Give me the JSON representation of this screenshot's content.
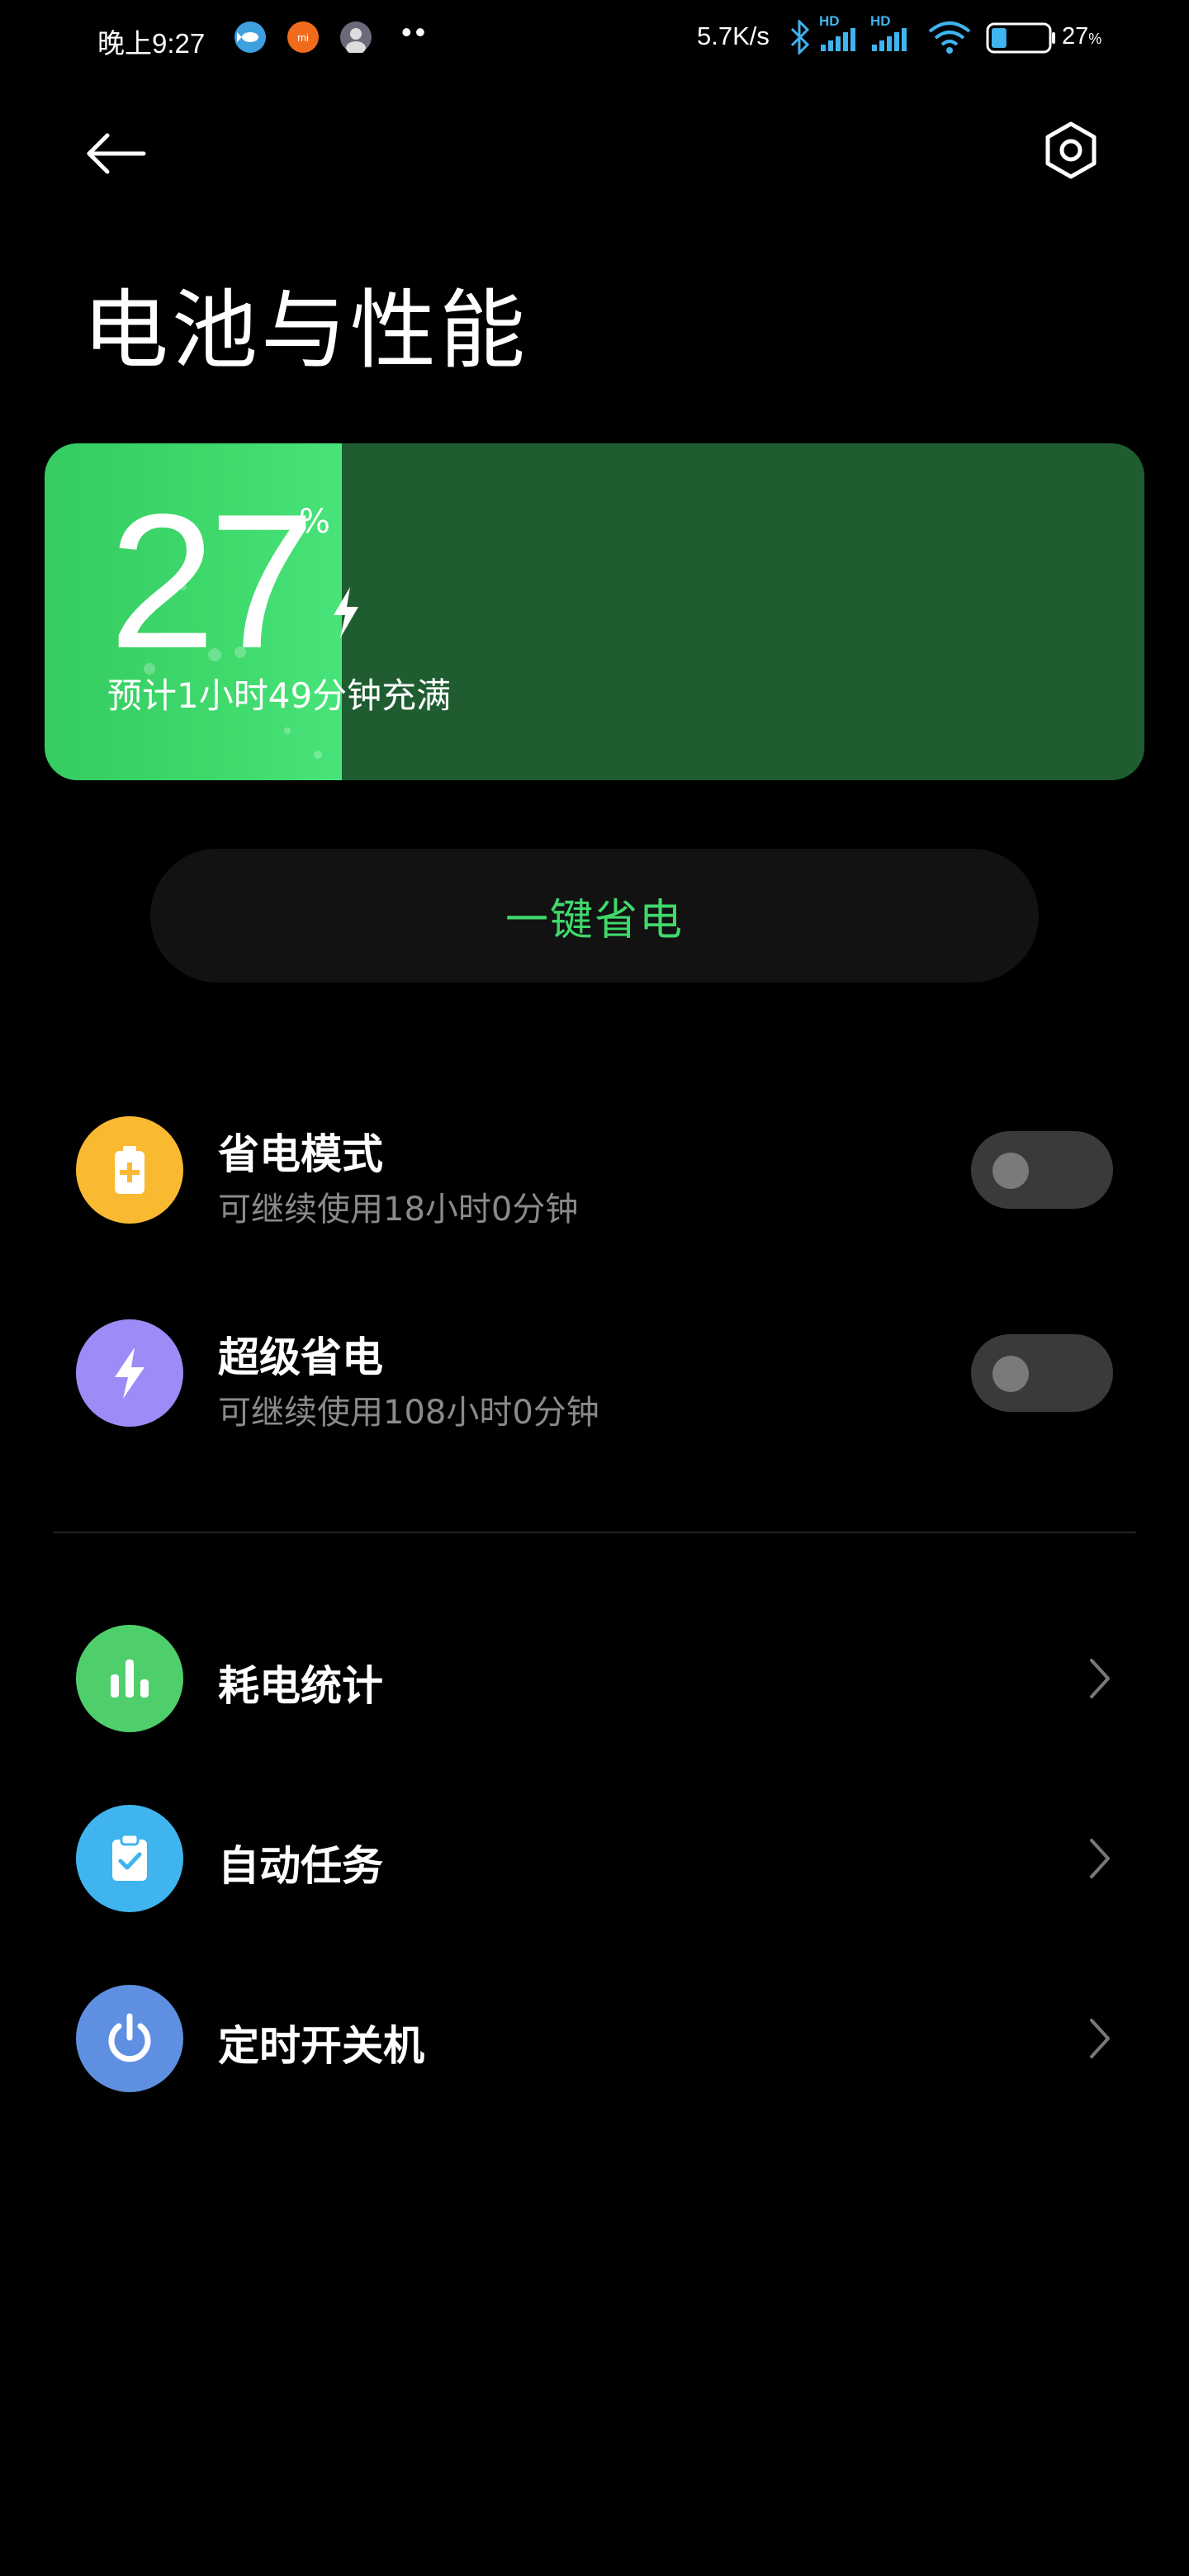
{
  "status_bar": {
    "time": "晚上9:27",
    "more_dots": "••",
    "net_speed": "5.7K/s",
    "hd1": "HD",
    "hd2": "HD",
    "battery_percent": "27",
    "battery_percent_suffix": "%",
    "battery_level": 0.27,
    "mi_badge": "mi"
  },
  "header": {
    "title": "电池与性能",
    "back_icon": "arrow-left-icon",
    "settings_icon": "gear-hex-icon"
  },
  "battery_card": {
    "level": "27",
    "unit": "%",
    "estimate": "预计1小时49分钟充满",
    "fill_fraction": 0.27,
    "colors": {
      "fill": "#3fd96c",
      "track": "#1f5d31"
    }
  },
  "one_key_save": {
    "label": "一键省电",
    "color": "#3fd96c"
  },
  "modes": [
    {
      "title": "省电模式",
      "subtitle": "可继续使用18小时0分钟",
      "icon": "battery-plus-icon",
      "color": "#f9b931",
      "enabled": false
    },
    {
      "title": "超级省电",
      "subtitle": "可继续使用108小时0分钟",
      "icon": "lightning-icon",
      "color": "#9b8cf7",
      "enabled": false
    }
  ],
  "menu": [
    {
      "title": "耗电统计",
      "icon": "bar-chart-icon",
      "color": "#4fcf6b"
    },
    {
      "title": "自动任务",
      "icon": "clipboard-check-icon",
      "color": "#3fb4ef"
    },
    {
      "title": "定时开关机",
      "icon": "power-icon",
      "color": "#5f8fe0"
    }
  ]
}
